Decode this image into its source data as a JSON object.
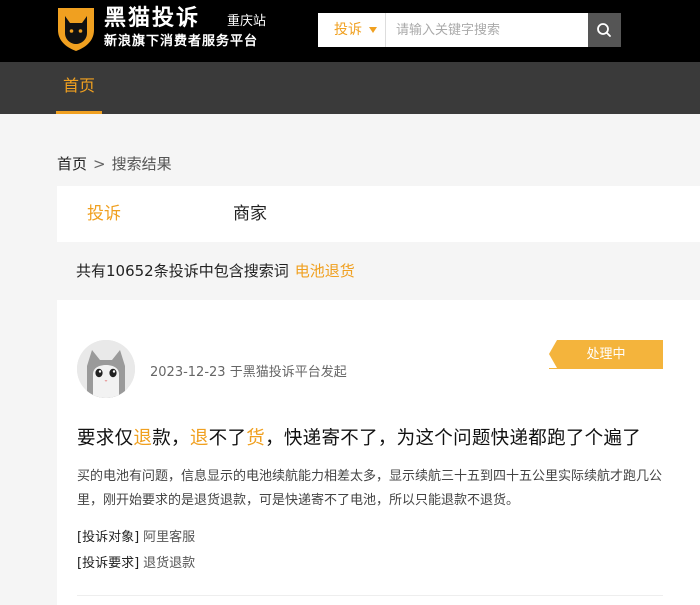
{
  "header": {
    "logo_title": "黑猫投诉",
    "logo_subtitle": "新浪旗下消费者服务平台",
    "station": "重庆站",
    "search": {
      "type_label": "投诉",
      "placeholder": "请输入关键字搜索",
      "value": ""
    },
    "logo_icon": "black-cat-shield-icon",
    "search_icon": "magnifier-icon"
  },
  "nav": {
    "home_label": "首页"
  },
  "breadcrumb": {
    "home": "首页",
    "separator": ">",
    "current": "搜索结果"
  },
  "tabs": [
    {
      "label": "投诉",
      "active": true
    },
    {
      "label": "商家",
      "active": false
    }
  ],
  "results": {
    "prefix": "共有10652条投诉中包含搜索词",
    "keyword": "电池退货"
  },
  "complaint": {
    "date": "2023-12-23",
    "source": "于黑猫投诉平台发起",
    "status": "处理中",
    "title_parts": [
      {
        "text": "要求仅",
        "hl": false
      },
      {
        "text": "退",
        "hl": true
      },
      {
        "text": "款，",
        "hl": false
      },
      {
        "text": "退",
        "hl": true
      },
      {
        "text": "不了",
        "hl": false
      },
      {
        "text": "货",
        "hl": true
      },
      {
        "text": "，快递寄不了，为这个问题快递都跑了个遍了",
        "hl": false
      }
    ],
    "description": "买的电池有问题，信息显示的电池续航能力相差太多，显示续航三十五到四十五公里实际续航才跑几公里，刚开始要求的是退货退款，可是快递寄不了电池，所以只能退款不退货。",
    "target_label": "[投诉对象]",
    "target_value": "阿里客服",
    "demand_label": "[投诉要求]",
    "demand_value": "退货退款"
  },
  "colors": {
    "accent": "#f0a020",
    "status_bg": "#f4b43c",
    "topbar": "#000000",
    "navbar": "#3a3a3a"
  }
}
